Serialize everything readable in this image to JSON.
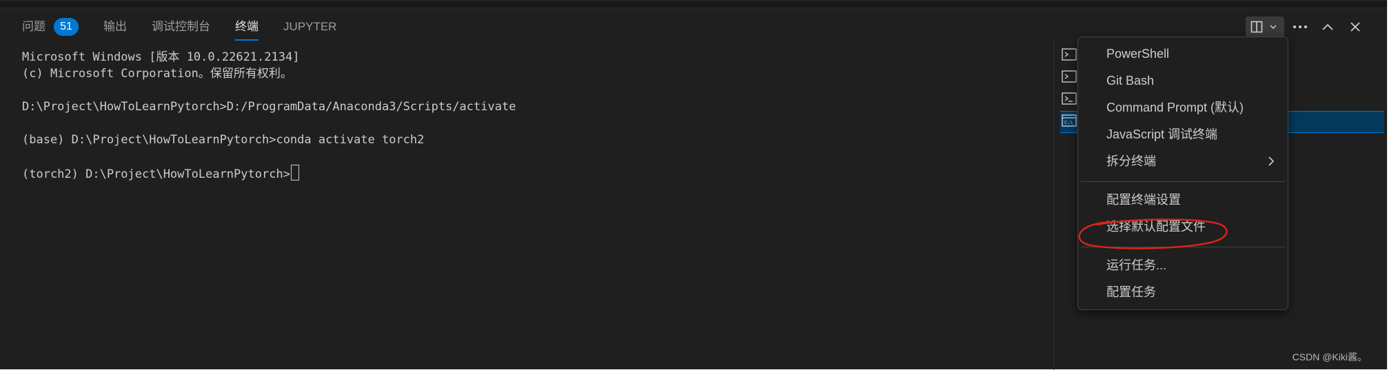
{
  "tabs": [
    {
      "label": "问题",
      "badge": "51",
      "active": false
    },
    {
      "label": "输出",
      "active": false
    },
    {
      "label": "调试控制台",
      "active": false
    },
    {
      "label": "终端",
      "active": true
    },
    {
      "label": "JUPYTER",
      "active": false
    }
  ],
  "toolbar": {
    "icons": [
      "split-editor-icon",
      "chevron-down-icon",
      "more-actions-icon",
      "maximize-panel-icon",
      "close-panel-icon"
    ]
  },
  "terminal": {
    "lines": [
      "Microsoft Windows [版本 10.0.22621.2134]",
      "(c) Microsoft Corporation。保留所有权利。",
      "",
      "D:\\Project\\HowToLearnPytorch>D:/ProgramData/Anaconda3/Scripts/activate",
      "",
      "(base) D:\\Project\\HowToLearnPytorch>conda activate torch2",
      "",
      "(torch2) D:\\Project\\HowToLearnPytorch>"
    ]
  },
  "terminal_list": {
    "items": [
      {
        "icon": "terminal-icon",
        "selected": false
      },
      {
        "icon": "terminal-icon",
        "selected": false
      },
      {
        "icon": "terminal-bash-icon",
        "selected": false
      },
      {
        "icon": "terminal-cmd-icon",
        "selected": true
      }
    ]
  },
  "menu": {
    "items": [
      {
        "label": "PowerShell"
      },
      {
        "label": "Git Bash"
      },
      {
        "label": "Command Prompt (默认)"
      },
      {
        "label": "JavaScript 调试终端"
      },
      {
        "label": "拆分终端",
        "submenu": true
      },
      {
        "label": "配置终端设置"
      },
      {
        "label": "选择默认配置文件",
        "highlighted_by_annotation": true
      },
      {
        "label": "运行任务..."
      },
      {
        "label": "配置任务"
      }
    ]
  },
  "watermark": "CSDN @Kiki酱。",
  "colors": {
    "panel_bg": "#1f1f1f",
    "accent": "#0078d4",
    "text": "#cccccc",
    "annotation_red": "#e0231c"
  }
}
